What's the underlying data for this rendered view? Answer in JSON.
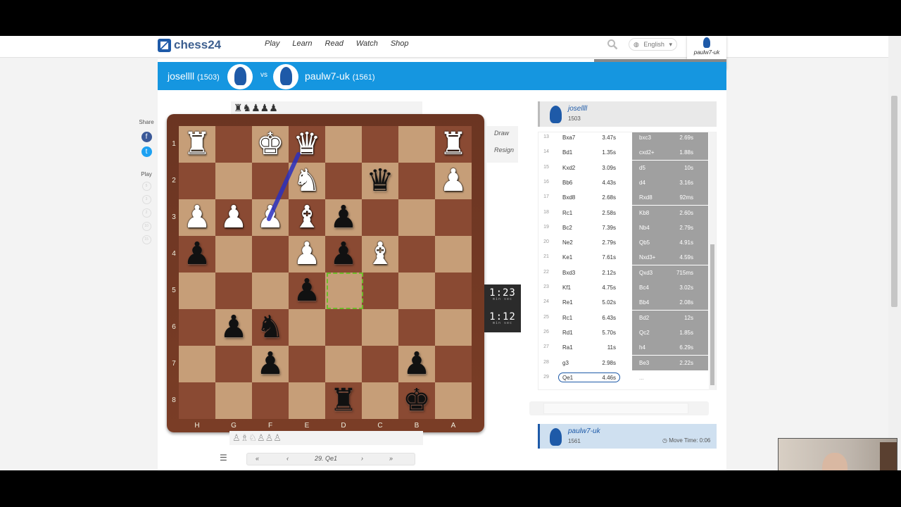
{
  "nav": {
    "logo": "chess24",
    "items": [
      "Play",
      "Learn",
      "Read",
      "Watch",
      "Shop"
    ]
  },
  "language": "English",
  "user": {
    "name": "paulw7-uk"
  },
  "game": {
    "white": {
      "name": "josellll",
      "rating": "(1503)"
    },
    "black": {
      "name": "paulw7-uk",
      "rating": "(1561)"
    },
    "vs": "vs"
  },
  "sidebar": {
    "share_label": "Share",
    "play_label": "Play",
    "dots": [
      "5",
      "3",
      "2",
      "10",
      "15"
    ]
  },
  "captured": {
    "top": "♜♞♟♟♟",
    "bottom": "♙♗♘♙♙♙"
  },
  "board": {
    "ranks": [
      "1",
      "2",
      "3",
      "4",
      "5",
      "6",
      "7",
      "8"
    ],
    "files": [
      "H",
      "G",
      "F",
      "E",
      "D",
      "C",
      "B",
      "A"
    ],
    "pieces": [
      {
        "r": 0,
        "c": 0,
        "g": "♜",
        "color": "w"
      },
      {
        "r": 0,
        "c": 2,
        "g": "♚",
        "color": "w"
      },
      {
        "r": 0,
        "c": 3,
        "g": "♛",
        "color": "w"
      },
      {
        "r": 0,
        "c": 7,
        "g": "♜",
        "color": "w"
      },
      {
        "r": 1,
        "c": 3,
        "g": "♞",
        "color": "w"
      },
      {
        "r": 1,
        "c": 5,
        "g": "♛",
        "color": "b"
      },
      {
        "r": 1,
        "c": 7,
        "g": "♟",
        "color": "w"
      },
      {
        "r": 2,
        "c": 0,
        "g": "♟",
        "color": "w"
      },
      {
        "r": 2,
        "c": 1,
        "g": "♟",
        "color": "w"
      },
      {
        "r": 2,
        "c": 2,
        "g": "♟",
        "color": "w"
      },
      {
        "r": 2,
        "c": 3,
        "g": "♝",
        "color": "w"
      },
      {
        "r": 2,
        "c": 4,
        "g": "♟",
        "color": "b"
      },
      {
        "r": 3,
        "c": 0,
        "g": "♟",
        "color": "b"
      },
      {
        "r": 3,
        "c": 3,
        "g": "♟",
        "color": "w"
      },
      {
        "r": 3,
        "c": 4,
        "g": "♟",
        "color": "b"
      },
      {
        "r": 3,
        "c": 5,
        "g": "♝",
        "color": "w"
      },
      {
        "r": 4,
        "c": 3,
        "g": "♟",
        "color": "b"
      },
      {
        "r": 5,
        "c": 1,
        "g": "♟",
        "color": "b"
      },
      {
        "r": 5,
        "c": 2,
        "g": "♞",
        "color": "b"
      },
      {
        "r": 6,
        "c": 2,
        "g": "♟",
        "color": "b"
      },
      {
        "r": 6,
        "c": 6,
        "g": "♟",
        "color": "b"
      },
      {
        "r": 7,
        "c": 4,
        "g": "♜",
        "color": "b"
      },
      {
        "r": 7,
        "c": 6,
        "g": "♚",
        "color": "b"
      }
    ],
    "highlight_square": "D4"
  },
  "actions": {
    "draw": "Draw",
    "resign": "Resign"
  },
  "clocks": {
    "top": {
      "value": "1:23",
      "units": "min sec"
    },
    "bottom": {
      "value": "1:12",
      "units": "min sec"
    }
  },
  "move_nav": {
    "current": "29. Qe1"
  },
  "players_panel": {
    "top": {
      "name": "josellll",
      "rating": "1503"
    },
    "bottom": {
      "name": "paulw7-uk",
      "rating": "1561",
      "move_time": "Move Time: 0:06"
    }
  },
  "moves": [
    {
      "n": "13",
      "w": "Bxa7",
      "wt": "3.47s",
      "b": "bxc3",
      "bt": "2.69s"
    },
    {
      "n": "14",
      "w": "Bd1",
      "wt": "1.35s",
      "b": "cxd2+",
      "bt": "1.88s"
    },
    {
      "n": "15",
      "w": "Kxd2",
      "wt": "3.09s",
      "b": "d5",
      "bt": "10s"
    },
    {
      "n": "16",
      "w": "Bb6",
      "wt": "4.43s",
      "b": "d4",
      "bt": "3.16s"
    },
    {
      "n": "17",
      "w": "Bxd8",
      "wt": "2.68s",
      "b": "Rxd8",
      "bt": "92ms"
    },
    {
      "n": "18",
      "w": "Rc1",
      "wt": "2.58s",
      "b": "Kb8",
      "bt": "2.60s"
    },
    {
      "n": "19",
      "w": "Bc2",
      "wt": "7.39s",
      "b": "Nb4",
      "bt": "2.79s"
    },
    {
      "n": "20",
      "w": "Ne2",
      "wt": "2.79s",
      "b": "Qb5",
      "bt": "4.91s"
    },
    {
      "n": "21",
      "w": "Ke1",
      "wt": "7.61s",
      "b": "Nxd3+",
      "bt": "4.59s"
    },
    {
      "n": "22",
      "w": "Bxd3",
      "wt": "2.12s",
      "b": "Qxd3",
      "bt": "715ms"
    },
    {
      "n": "23",
      "w": "Kf1",
      "wt": "4.75s",
      "b": "Bc4",
      "bt": "3.02s"
    },
    {
      "n": "24",
      "w": "Re1",
      "wt": "5.02s",
      "b": "Bb4",
      "bt": "2.08s"
    },
    {
      "n": "25",
      "w": "Rc1",
      "wt": "6.43s",
      "b": "Bd2",
      "bt": "12s"
    },
    {
      "n": "26",
      "w": "Rd1",
      "wt": "5.70s",
      "b": "Qc2",
      "bt": "1.85s"
    },
    {
      "n": "27",
      "w": "Ra1",
      "wt": "11s",
      "b": "h4",
      "bt": "6.29s"
    },
    {
      "n": "28",
      "w": "g3",
      "wt": "2.98s",
      "b": "Be3",
      "bt": "2.22s"
    },
    {
      "n": "29",
      "w": "Qe1",
      "wt": "4.46s",
      "b": "...",
      "bt": ""
    }
  ],
  "colors": {
    "accent": "#1596e0",
    "brand": "#1e5aa8",
    "light_square": "#c69e78",
    "dark_square": "#8a4a33",
    "highlight": "#6fbb2a"
  }
}
